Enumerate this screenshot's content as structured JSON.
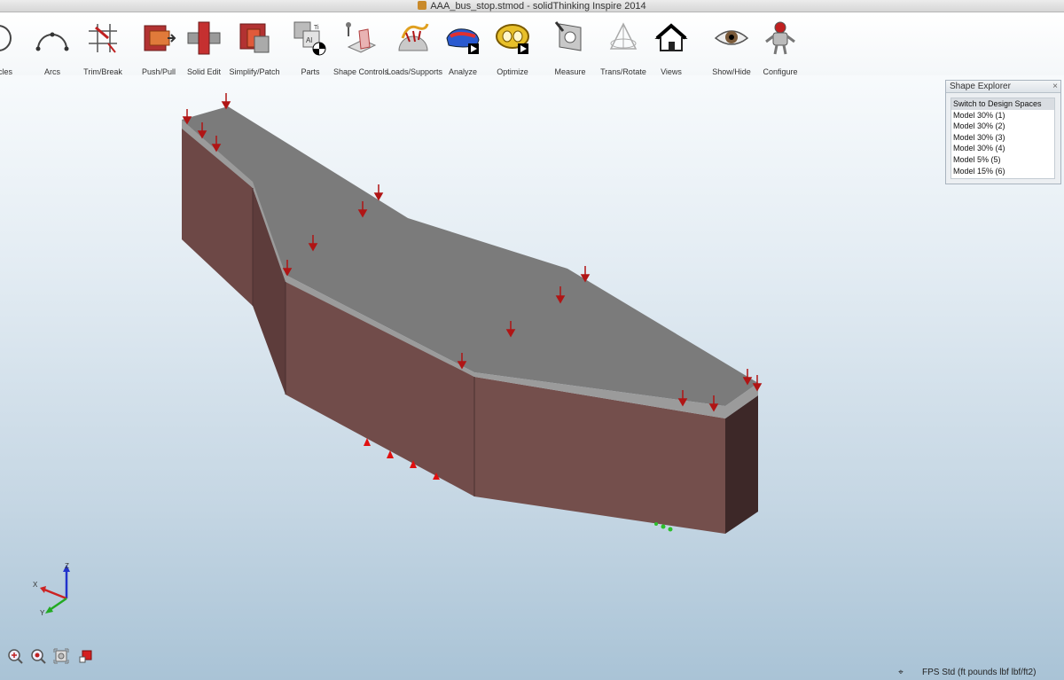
{
  "window": {
    "title": "AAA_bus_stop.stmod - solidThinking Inspire 2014"
  },
  "toolbar": {
    "items": [
      {
        "label": "cles",
        "icon": "circles-icon"
      },
      {
        "label": "Arcs",
        "icon": "arcs-icon"
      },
      {
        "label": "Trim/Break",
        "icon": "trim-break-icon"
      },
      {
        "label": "Push/Pull",
        "icon": "push-pull-icon"
      },
      {
        "label": "Solid Edit",
        "icon": "solid-edit-icon"
      },
      {
        "label": "Simplify/Patch",
        "icon": "simplify-patch-icon"
      },
      {
        "label": "Parts",
        "icon": "parts-icon"
      },
      {
        "label": "Shape Controls",
        "icon": "shape-controls-icon"
      },
      {
        "label": "Loads/Supports",
        "icon": "loads-supports-icon"
      },
      {
        "label": "Analyze",
        "icon": "analyze-icon"
      },
      {
        "label": "Optimize",
        "icon": "optimize-icon"
      },
      {
        "label": "Measure",
        "icon": "measure-icon"
      },
      {
        "label": "Trans/Rotate",
        "icon": "trans-rotate-icon"
      },
      {
        "label": "Views",
        "icon": "views-icon"
      },
      {
        "label": "Show/Hide",
        "icon": "show-hide-icon"
      },
      {
        "label": "Configure",
        "icon": "configure-icon"
      }
    ]
  },
  "shape_explorer": {
    "title": "Shape Explorer",
    "close": "×",
    "items": [
      "Switch to Design Spaces",
      "Model 30% (1)",
      "Model 30% (2)",
      "Model 30% (3)",
      "Model 30% (4)",
      "Model 5% (5)",
      "Model 15% (6)"
    ]
  },
  "triad": {
    "x": "X",
    "y": "Y",
    "z": "Z"
  },
  "status": {
    "units": "FPS Std (ft pounds lbf lbf/ft2)"
  },
  "colors": {
    "top_face": "#808080",
    "side_face": "#704c4a",
    "load_arrow": "#b01515",
    "support": "#e01010"
  }
}
